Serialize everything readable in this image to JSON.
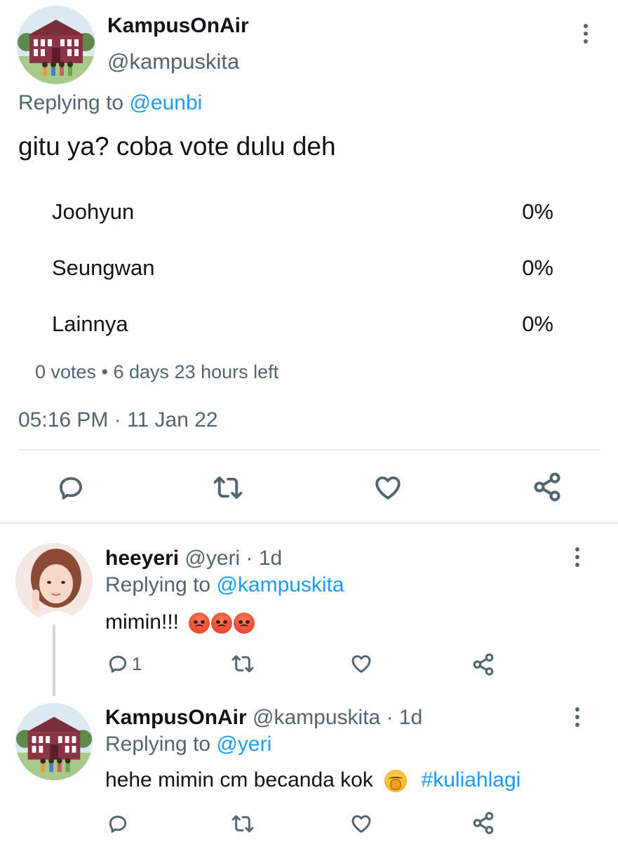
{
  "tweet": {
    "display_name": "KampusOnAir",
    "handle": "@kampuskita",
    "replying_prefix": "Replying to",
    "replying_to": "@eunbi",
    "text": "gitu ya? coba vote dulu deh",
    "poll": {
      "options": [
        {
          "label": "Joohyun",
          "percent": "0%"
        },
        {
          "label": "Seungwan",
          "percent": "0%"
        },
        {
          "label": "Lainnya",
          "percent": "0%"
        }
      ],
      "meta": "0 votes • 6 days 23 hours left"
    },
    "timestamp": "05:16 PM · 11 Jan 22"
  },
  "replies": [
    {
      "display_name": "heeyeri",
      "handle_time": "@yeri · 1d",
      "replying_prefix": "Replying to",
      "replying_to": "@kampuskita",
      "text": "mimin!!!",
      "reply_count": "1"
    },
    {
      "display_name": "KampusOnAir",
      "handle_time": "@kampuskita · 1d",
      "replying_prefix": "Replying to",
      "replying_to": "@yeri",
      "text": "hehe mimin cm becanda kok",
      "hashtag": "#kuliahlagi"
    }
  ],
  "icons": {
    "reply": "reply-icon",
    "retweet": "retweet-icon",
    "like": "heart-icon",
    "share": "share-icon",
    "more": "more-vertical-icon"
  },
  "colors": {
    "link": "#1d9bf0",
    "secondary_text": "#536471",
    "divider": "#e6ecf0"
  }
}
